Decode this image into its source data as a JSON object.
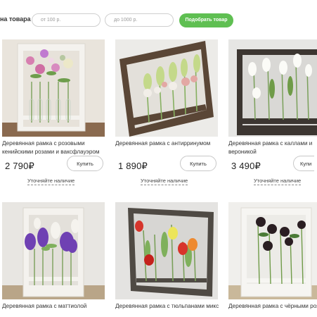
{
  "filter": {
    "label": "на товара",
    "from_placeholder": "от 100 р.",
    "to_placeholder": "до 1000 р.",
    "button_label": "Подобрать товар"
  },
  "products": [
    {
      "name": "Деревянная рамка с розовыми кенийскими розами и ваксфлауэром",
      "price": "2 790₽",
      "buy_label": "Купить",
      "availability": "Уточняйте наличие"
    },
    {
      "name": "Деревянная рамка с антирринумом",
      "price": "1 890₽",
      "buy_label": "Купить",
      "availability": "Уточняйте наличие"
    },
    {
      "name": "Деревянная рамка с каллами и вероникой",
      "price": "3 490₽",
      "buy_label": "Купи",
      "availability": "Уточняйте наличие"
    },
    {
      "name": "Деревянная рамка с маттиолой"
    },
    {
      "name": "Деревянная рамка с тюльпанами микс"
    },
    {
      "name": "Деревянная рамка с чёрными розами"
    }
  ],
  "colors": {
    "accent_green": "#5fbf52",
    "frame_white": "#f4f2ee",
    "frame_dark_wood": "#4a3d32"
  }
}
